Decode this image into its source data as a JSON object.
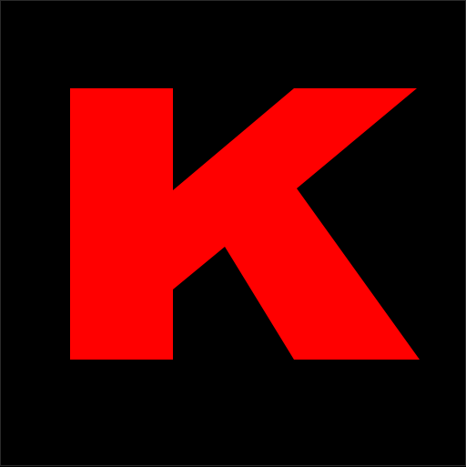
{
  "logo": {
    "letter": "K",
    "letter_color": "#ff0000",
    "background_color": "#000000",
    "icon": "letter-k-logo-icon"
  }
}
